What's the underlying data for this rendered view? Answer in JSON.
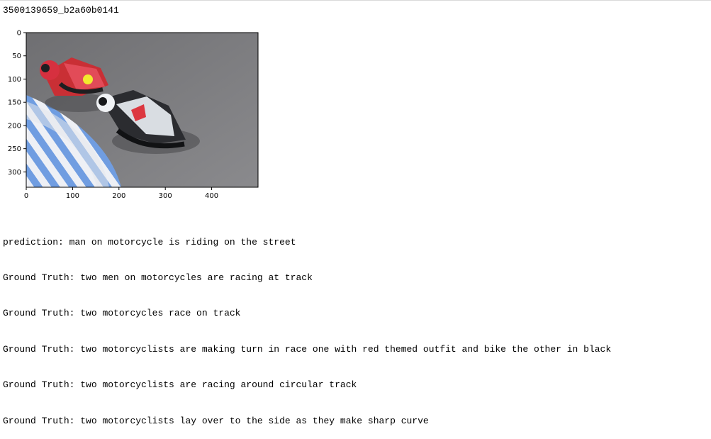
{
  "output": {
    "image_id": "3500139659_b2a60b0141"
  },
  "image_plot": {
    "y_ticks": [
      "0",
      "50",
      "100",
      "150",
      "200",
      "250",
      "300"
    ],
    "x_ticks": [
      "0",
      "100",
      "200",
      "300",
      "400"
    ],
    "image_size": [
      500,
      333
    ]
  },
  "results": {
    "prediction_label": "prediction:",
    "prediction_text": "man on motorcycle is riding on the street",
    "ground_truth_label": "Ground Truth:",
    "ground_truths": [
      "two men on motorcycles are racing at track",
      "two motorcycles race on track",
      "two motorcyclists are making turn in race one with red themed outfit and bike the other in black",
      "two motorcyclists are racing around circular track",
      "two motorcyclists lay over to the side as they make sharp curve"
    ]
  }
}
